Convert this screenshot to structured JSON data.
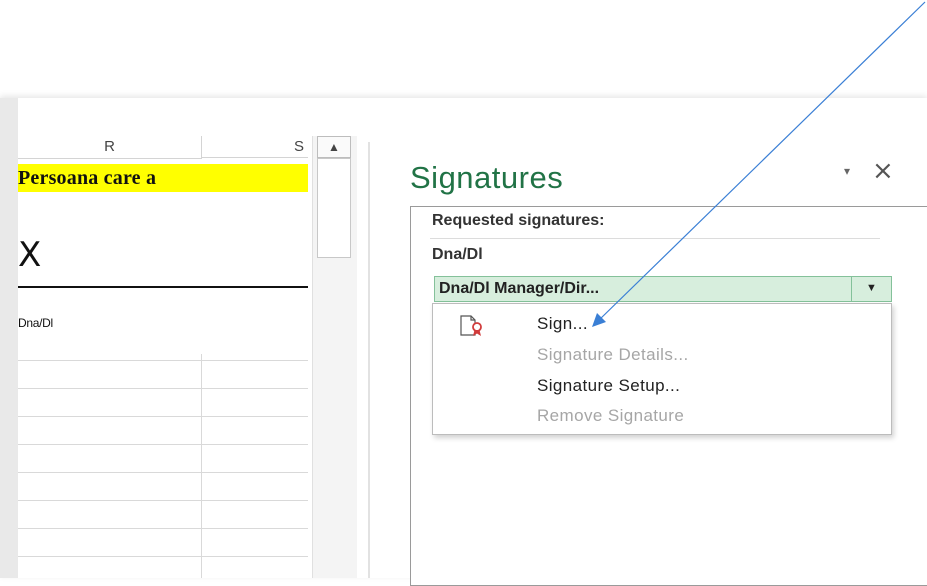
{
  "spreadsheet": {
    "column_headers": [
      "R",
      "S"
    ],
    "yellow_cell_text": "Persoana care a",
    "signature_x": "X",
    "signer_line_text": "Dna/Dl",
    "scroll_up_glyph": "▲"
  },
  "signatures_pane": {
    "title": "Signatures",
    "menu_glyph": "▾",
    "close_glyph": "×",
    "requested_label": "Requested signatures:",
    "signer_name": "Dna/Dl",
    "signature_item": "Dna/Dl Manager/Dir...",
    "dropdown_glyph": "▼",
    "context_menu": [
      {
        "label": "Sign...",
        "enabled": true
      },
      {
        "label": "Signature Details...",
        "enabled": false
      },
      {
        "label": "Signature Setup...",
        "enabled": true
      },
      {
        "label": "Remove Signature",
        "enabled": false
      }
    ]
  },
  "colors": {
    "pane_title": "#217346",
    "highlight_cell": "#ffff00",
    "selected_item_bg": "#d7eedd",
    "annotation_arrow": "#3a7fd5"
  }
}
